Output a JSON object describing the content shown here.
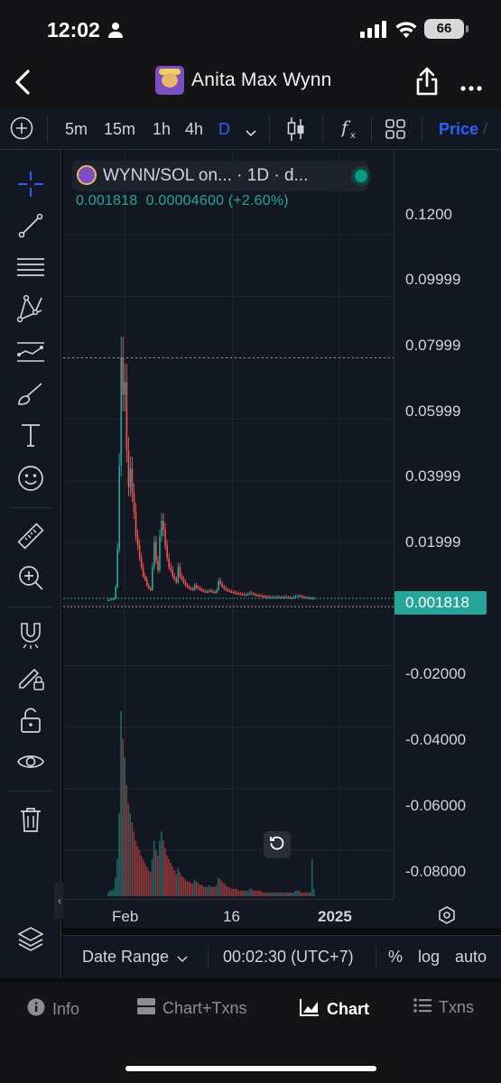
{
  "status_bar": {
    "time": "12:02",
    "battery": "66"
  },
  "header": {
    "title": "Anita Max Wynn",
    "back_icon": "chevron-left-icon",
    "share_icon": "share-icon",
    "more_icon": "more-horizontal-icon"
  },
  "toolbar": {
    "intervals": [
      "5m",
      "15m",
      "1h",
      "4h",
      "D"
    ],
    "active_interval": "D",
    "price_label": "Price",
    "price_separator": "/"
  },
  "legend": {
    "symbol": "WYNN/SOL on... · 1D · d...",
    "close": "0.001818",
    "change": "0.00004600",
    "change_pct": "(+2.60%)"
  },
  "price_scale": {
    "labels": [
      "0.1200",
      "0.09999",
      "0.07999",
      "0.05999",
      "0.03999",
      "0.01999",
      "-0.02000",
      "-0.04000",
      "-0.06000",
      "-0.08000"
    ],
    "last_price": "0.001818",
    "last_price_color": "#26a69a"
  },
  "time_scale": {
    "labels": [
      "Feb",
      "16",
      "2025"
    ]
  },
  "bottom_bar": {
    "date_range": "Date Range",
    "clock": "00:02:30 (UTC+7)",
    "percent": "%",
    "log": "log",
    "auto": "auto"
  },
  "tabs": [
    {
      "label": "Info",
      "icon": "info-icon"
    },
    {
      "label": "Chart+Txns",
      "icon": "split-view-icon"
    },
    {
      "label": "Chart",
      "icon": "area-chart-icon"
    },
    {
      "label": "Txns",
      "icon": "list-icon"
    }
  ],
  "active_tab": "Chart",
  "colors": {
    "up": "#26a69a",
    "down": "#ef5350",
    "accent": "#2962ff",
    "background": "#131722"
  },
  "chart_data": {
    "type": "candlestick",
    "ylim": [
      -0.09,
      0.13
    ],
    "x_tick_labels": [
      "Feb",
      "16",
      "2025"
    ],
    "y_tick_labels": [
      "0.1200",
      "0.09999",
      "0.07999",
      "0.05999",
      "0.03999",
      "0.01999",
      "-0.02000",
      "-0.04000",
      "-0.06000",
      "-0.08000"
    ],
    "series": [
      {
        "values": [
          0.0012,
          0.0014,
          0.0015,
          0.0016,
          0.0055,
          0.018,
          0.045,
          0.08,
          0.068,
          0.072,
          0.05,
          0.038,
          0.044,
          0.036,
          0.03,
          0.022,
          0.019,
          0.015,
          0.012,
          0.009,
          0.008,
          0.006,
          0.005,
          0.0045,
          0.012,
          0.02,
          0.014,
          0.011,
          0.022,
          0.027,
          0.024,
          0.019,
          0.015,
          0.012,
          0.011,
          0.009,
          0.008,
          0.007,
          0.012,
          0.009,
          0.008,
          0.007,
          0.006,
          0.0055,
          0.005,
          0.0048,
          0.0046,
          0.006,
          0.0052,
          0.005,
          0.0045,
          0.0043,
          0.004,
          0.0038,
          0.004,
          0.0042,
          0.004,
          0.0038,
          0.0036,
          0.0045,
          0.0075,
          0.0065,
          0.0055,
          0.005,
          0.0045,
          0.0042,
          0.004,
          0.0038,
          0.0037,
          0.0035,
          0.0033,
          0.0032,
          0.0031,
          0.003,
          0.0029,
          0.003,
          0.0031,
          0.0035,
          0.0033,
          0.003,
          0.0028,
          0.0027,
          0.0026,
          0.0025,
          0.0024,
          0.0023,
          0.0022,
          0.0022,
          0.0021,
          0.0021,
          0.002,
          0.0021,
          0.0022,
          0.0021,
          0.002,
          0.0021,
          0.0022,
          0.0021,
          0.002,
          0.0019,
          0.0019,
          0.0021,
          0.0024,
          0.0026,
          0.0025,
          0.0023,
          0.0021,
          0.002,
          0.0019,
          0.0019,
          0.0018,
          0.0018,
          0.0018
        ]
      }
    ],
    "volume": [
      0.02,
      0.03,
      0.03,
      0.04,
      0.1,
      0.2,
      0.45,
      1.0,
      0.85,
      0.75,
      0.6,
      0.5,
      0.45,
      0.4,
      0.35,
      0.3,
      0.27,
      0.25,
      0.22,
      0.2,
      0.18,
      0.16,
      0.14,
      0.13,
      0.2,
      0.3,
      0.25,
      0.22,
      0.3,
      0.35,
      0.3,
      0.26,
      0.22,
      0.2,
      0.18,
      0.16,
      0.14,
      0.12,
      0.15,
      0.13,
      0.11,
      0.1,
      0.09,
      0.08,
      0.08,
      0.07,
      0.07,
      0.09,
      0.08,
      0.07,
      0.06,
      0.06,
      0.05,
      0.05,
      0.05,
      0.06,
      0.05,
      0.05,
      0.05,
      0.06,
      0.1,
      0.09,
      0.08,
      0.07,
      0.06,
      0.05,
      0.05,
      0.04,
      0.04,
      0.04,
      0.04,
      0.03,
      0.03,
      0.03,
      0.03,
      0.03,
      0.03,
      0.04,
      0.04,
      0.03,
      0.03,
      0.03,
      0.03,
      0.03,
      0.02,
      0.02,
      0.02,
      0.02,
      0.02,
      0.02,
      0.02,
      0.02,
      0.02,
      0.02,
      0.02,
      0.02,
      0.02,
      0.02,
      0.02,
      0.02,
      0.02,
      0.02,
      0.03,
      0.03,
      0.03,
      0.02,
      0.02,
      0.02,
      0.02,
      0.02,
      0.02,
      0.2,
      0.04
    ]
  }
}
